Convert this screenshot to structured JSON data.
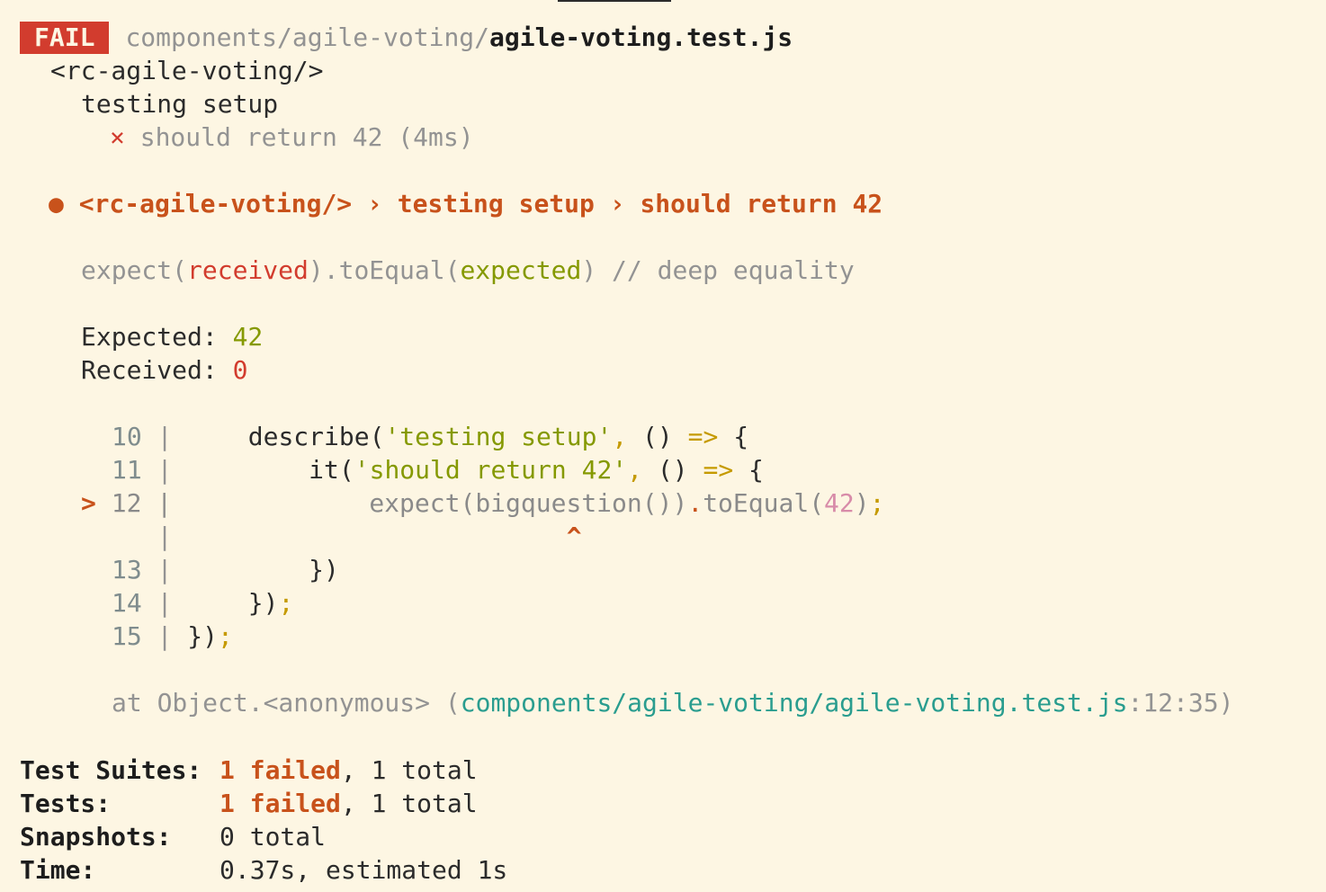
{
  "header": {
    "status_badge": "FAIL",
    "file_dir": "components/agile-voting/",
    "file_name": "agile-voting.test.js"
  },
  "tree": {
    "component": "<rc-agile-voting/>",
    "describe": "testing setup",
    "failure_mark": "×",
    "test_name": "should return 42 (4ms)"
  },
  "error_header": {
    "bullet": "●",
    "text": "<rc-agile-voting/> › testing setup › should return 42"
  },
  "matcher": {
    "prefix": "expect(",
    "received": "received",
    "middle": ").toEqual(",
    "expected": "expected",
    "suffix": ") // deep equality"
  },
  "values": {
    "expected_label": "Expected: ",
    "expected_value": "42",
    "received_label": "Received: ",
    "received_value": "0"
  },
  "code": {
    "l10_num": "10",
    "l10_pre": "describe(",
    "l10_str": "'testing setup'",
    "l10_comma": ",",
    "l10_mid": " () ",
    "l10_arrow": "=>",
    "l10_end": " {",
    "l11_num": "11",
    "l11_pre": "it(",
    "l11_str": "'should return 42'",
    "l11_comma": ",",
    "l11_mid": " () ",
    "l11_arrow": "=>",
    "l11_end": " {",
    "l12_marker": ">",
    "l12_num": "12",
    "l12_pre": "expect(bigquestion())",
    "l12_dot": ".",
    "l12_call": "toEqual(",
    "l12_num_arg": "42",
    "l12_close": ")",
    "l12_semi": ";",
    "caret": "^",
    "l13_num": "13",
    "l13_text": "})",
    "l14_num": "14",
    "l14_text": "})",
    "l14_semi": ";",
    "l15_num": "15",
    "l15_text": "})",
    "l15_semi": ";",
    "gutter": "|"
  },
  "stack": {
    "prefix": "at Object.<anonymous> (",
    "path": "components/agile-voting/agile-voting.test.js",
    "location": ":12:35)"
  },
  "summary": {
    "suites_label": "Test Suites:",
    "suites_failed": "1 failed",
    "suites_rest": ", 1 total",
    "tests_label": "Tests:",
    "tests_failed": "1 failed",
    "tests_rest": ", 1 total",
    "snapshots_label": "Snapshots:",
    "snapshots_value": "0 total",
    "time_label": "Time:",
    "time_value": "0.37s, estimated 1s"
  }
}
